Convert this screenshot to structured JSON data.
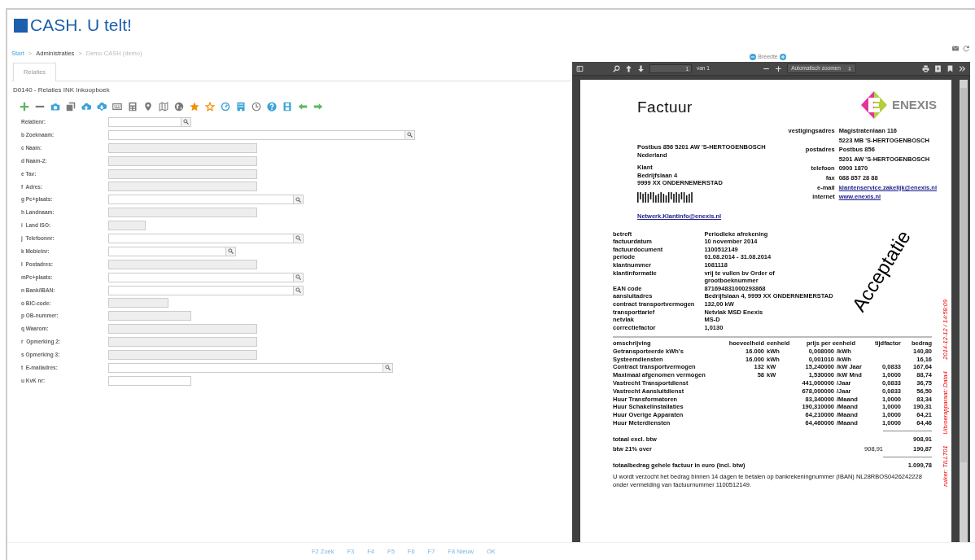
{
  "app": {
    "logo_text": "CASH. U telt!"
  },
  "breadcrumb": [
    {
      "text": "Start",
      "kind": "link"
    },
    {
      "text": ">",
      "kind": "separator"
    },
    {
      "text": "Administraties",
      "kind": "text"
    },
    {
      "text": ">",
      "kind": "separator"
    },
    {
      "text": "Demo CASH (demo)",
      "kind": "muted"
    }
  ],
  "tabs": [
    {
      "label": "Relaties",
      "selected": true
    }
  ],
  "form_title": "D0140 - Relaties INK Inkoopboek",
  "fields": [
    {
      "label": "Relatienr:",
      "kind": "search"
    },
    {
      "label": "b Zoeknaam:",
      "kind": "search"
    },
    {
      "label": "c Naam:",
      "kind": "readonly"
    },
    {
      "label": "d Naam-2:",
      "kind": "readonly"
    },
    {
      "label": "e Tav:",
      "kind": "readonly"
    },
    {
      "label": "f  Adres:",
      "kind": "readonly"
    },
    {
      "label": "g Pc+plaats:",
      "kind": "search"
    },
    {
      "label": "h Landnaam:",
      "kind": "readonly"
    },
    {
      "label": "i  Land ISO:",
      "kind": "readonly"
    },
    {
      "label": "j  Telefoonnr:",
      "kind": "search"
    },
    {
      "label": "k Mobielnr:",
      "kind": "search"
    },
    {
      "label": "l  Postadres:",
      "kind": "readonly"
    },
    {
      "label": "mPc+plaats:",
      "kind": "search"
    },
    {
      "label": "n Bank/IBAN:",
      "kind": "search"
    },
    {
      "label": "o BIC-code:",
      "kind": "readonly"
    },
    {
      "label": "p OB-nummer:",
      "kind": "readonly"
    },
    {
      "label": "q Waarom:",
      "kind": "readonly"
    },
    {
      "label": "r  Opmerking 2:",
      "kind": "readonly"
    },
    {
      "label": "s Opmerking 3:",
      "kind": "readonly"
    },
    {
      "label": "t  E-mailadres:",
      "kind": "search"
    },
    {
      "label": "u KvK nr:",
      "kind": "text"
    }
  ],
  "viewer": {
    "width_label": "Breedte",
    "page_number": "1",
    "page_count": "van 1",
    "zoom": "Automatisch zoomen"
  },
  "invoice": {
    "title": "Factuur",
    "logo_text": "ENEXIS",
    "sender_line": "Postbus 856 5201 AW 'S-HERTOGENBOSCH Nederland",
    "recipient": [
      "Klant",
      "Bedrijfslaan 4",
      "9999 XX ONDERNEMERSTAD"
    ],
    "contact": [
      {
        "label": "vestigingsadres",
        "lines": [
          "Magistratenlaan 116",
          "5223 MB 'S-HERTOGENBOSCH"
        ],
        "link": false
      },
      {
        "label": "postadres",
        "lines": [
          "Postbus 856",
          "5201 AW 'S-HERTOGENBOSCH"
        ],
        "link": false
      },
      {
        "label": "telefoon",
        "lines": [
          "0900 1870"
        ],
        "link": false
      },
      {
        "label": "fax",
        "lines": [
          "088 857 28 88"
        ],
        "link": false
      },
      {
        "label": "e-mail",
        "lines": [
          "klantenservice.zakelijk@enexis.nl"
        ],
        "link": true
      },
      {
        "label": "internet",
        "lines": [
          "www.enexis.nl"
        ],
        "link": true
      }
    ],
    "email_link": "Netwerk.Klantinfo@enexis.nl",
    "details": [
      {
        "label": "betreft",
        "lines": [
          "Periodieke afrekening"
        ]
      },
      {
        "label": "factuurdatum",
        "lines": [
          "10 november 2014"
        ]
      },
      {
        "label": "factuurdocument",
        "lines": [
          "1100512149"
        ]
      },
      {
        "label": "periode",
        "lines": [
          "01.08.2014 - 31.08.2014"
        ]
      },
      {
        "label": "klantnummer",
        "lines": [
          "1081118"
        ]
      },
      {
        "label": "klantinformatie",
        "lines": [
          "vrij te vullen bv Order of",
          "grootboeknummer"
        ]
      },
      {
        "label": "EAN code",
        "lines": [
          "871694831000293868"
        ]
      },
      {
        "label": "aansluitadres",
        "lines": [
          "Bedrijfslaan 4, 9999 XX ONDERNEMERSTAD"
        ]
      },
      {
        "label": "contract transportvermogen",
        "lines": [
          "132,00 kW"
        ]
      },
      {
        "label": "transporttarief",
        "lines": [
          "Netvlak MSD Enexis"
        ]
      },
      {
        "label": "netvlak",
        "lines": [
          "MS-D"
        ]
      },
      {
        "label": "correctiefactor",
        "lines": [
          "1,0130"
        ]
      }
    ],
    "columns": [
      "omschrijving",
      "hoeveelheid",
      "eenheid",
      "prijs per eenheid",
      "tijdfactor",
      "bedrag"
    ],
    "rows": [
      {
        "description": "Getransporteerde kWh's",
        "quantity": "16.000",
        "unit": "kWh",
        "price": "0,008000",
        "per": "/kWh",
        "amount": "140,80"
      },
      {
        "description": "Systeemdiensten",
        "quantity": "16.000",
        "unit": "kWh",
        "price": "0,001010",
        "per": "/kWh",
        "amount": "16,16"
      },
      {
        "description": "Contract transportvermogen",
        "quantity": "132",
        "unit": "kW",
        "price": "15,240000",
        "per": "/kW Jaar",
        "factor": "0,0833",
        "amount": "167,64"
      },
      {
        "description": "Maximaal afgenomen vermogen",
        "quantity": "58",
        "unit": "kW",
        "price": "1,530000",
        "per": "/kW Mnd",
        "factor": "1,0000",
        "amount": "88,74"
      },
      {
        "description": "Vastrecht Transportdienst",
        "price": "441,000000",
        "per": "/Jaar",
        "factor": "0,0833",
        "amount": "36,75"
      },
      {
        "description": "Vastrecht Aansluitdienst",
        "price": "678,000000",
        "per": "/Jaar",
        "factor": "0,0833",
        "amount": "56,50"
      },
      {
        "description": "Huur Transformatoren",
        "price": "83,340000",
        "per": "/Maand",
        "factor": "1,0000",
        "amount": "83,34"
      },
      {
        "description": "Huur Schakelinstallaties",
        "price": "190,310000",
        "per": "/Maand",
        "factor": "1,0000",
        "amount": "190,31"
      },
      {
        "description": "Huur Overige Apparaten",
        "price": "64,210000",
        "per": "/Maand",
        "factor": "1,0000",
        "amount": "64,21"
      },
      {
        "description": "Huur Meterdiensten",
        "price": "64,460000",
        "per": "/Maand",
        "factor": "1,0000",
        "amount": "64,46"
      }
    ],
    "totals": [
      {
        "label": "totaal excl. btw",
        "value": "908,91",
        "rule": true
      },
      {
        "label": "btw 21% over",
        "base": "908,91",
        "value": "190,87",
        "rule": false
      },
      {
        "label": "totaalbedrag gehele factuur in euro (incl. btw)",
        "value": "1.099,78",
        "rule": true
      }
    ],
    "payment_note": "U wordt verzocht het bedrag binnen 14 dagen te betalen op bankrekeningnummer (IBAN) NL28RBOS0426242228 onder vermelding van factuurnummer 1100512149.",
    "stamp": "Acceptatie",
    "side_note": [
      "ruiker: TILLT01",
      "Uitvoerapparaat: Data4",
      "2014-12-12 / 14:58:09"
    ]
  },
  "function_keys": [
    "F2 Zoek",
    "F3",
    "F4",
    "F5",
    "F6",
    "F7",
    "F8 Nieuw",
    "OK"
  ]
}
